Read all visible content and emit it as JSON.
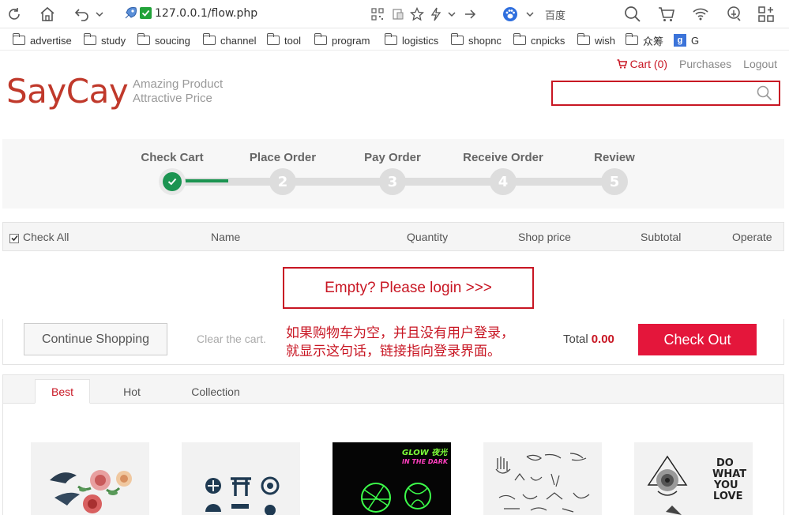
{
  "browser": {
    "url": "127.0.0.1/flow.php",
    "search_engine": "百度",
    "bookmarks": [
      "advertise",
      "study",
      "soucing",
      "channel",
      "tool",
      "program",
      "logistics",
      "shopnc",
      "cnpicks",
      "wish",
      "众筹",
      "G"
    ]
  },
  "header": {
    "cart_label": "Cart (0)",
    "purchases_label": "Purchases",
    "logout_label": "Logout",
    "logo": "SayCay",
    "slogan_line1": "Amazing Product",
    "slogan_line2": "Attractive Price",
    "search_placeholder": ""
  },
  "steps": [
    {
      "label": "Check Cart",
      "number": "✓",
      "active": true
    },
    {
      "label": "Place Order",
      "number": "2",
      "active": false
    },
    {
      "label": "Pay Order",
      "number": "3",
      "active": false
    },
    {
      "label": "Receive Order",
      "number": "4",
      "active": false
    },
    {
      "label": "Review",
      "number": "5",
      "active": false
    }
  ],
  "table_head": {
    "check_all": "Check All",
    "name": "Name",
    "quantity": "Quantity",
    "shop_price": "Shop price",
    "subtotal": "Subtotal",
    "operate": "Operate"
  },
  "empty_message": "Empty? Please login >>>",
  "cart_footer": {
    "continue_label": "Continue Shopping",
    "clear_label": "Clear the cart.",
    "note_line1": "如果购物车为空，并且没有用户登录，",
    "note_line2": "就显示这句话，链接指向登录界面。",
    "total_label": "Total",
    "total_value": "0.00",
    "checkout_label": "Check Out"
  },
  "recommend": {
    "tabs": [
      "Best",
      "Hot",
      "Collection"
    ],
    "active_tab": "Best",
    "glow_line1": "GLOW 夜光",
    "glow_line2": "IN THE DARK",
    "love_text": [
      "DO",
      "WHAT",
      "YOU",
      "LOVE"
    ]
  },
  "colors": {
    "brand_red": "#c81623",
    "logo_red": "#c0392b",
    "checkout_red": "#e4163b",
    "step_green": "#1b9451"
  }
}
